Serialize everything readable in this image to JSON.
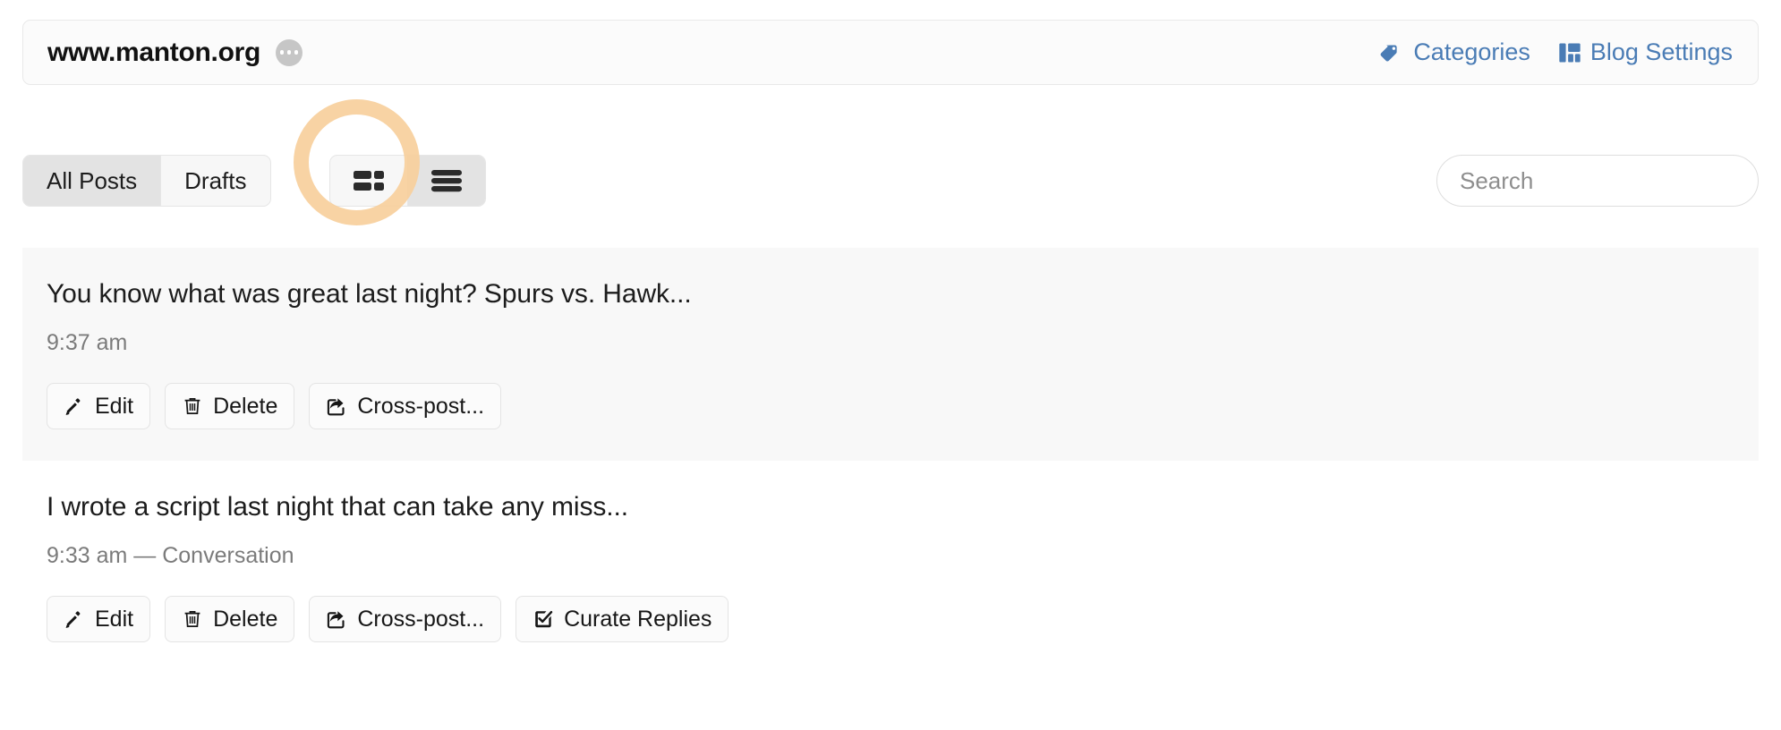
{
  "header": {
    "site_title": "www.manton.org",
    "more_button_label": "More options",
    "more_icon": "ellipsis-icon",
    "links": [
      {
        "label": "Categories",
        "icon": "tag-icon",
        "color": "#4a7cb5"
      },
      {
        "label": "Blog Settings",
        "icon": "layout-icon",
        "color": "#4a7cb5"
      }
    ]
  },
  "toolbar": {
    "tabs": [
      {
        "label": "All Posts",
        "selected": true
      },
      {
        "label": "Drafts",
        "selected": false
      }
    ],
    "views": [
      {
        "label": "Card view",
        "icon": "grid-view-icon",
        "selected": false
      },
      {
        "label": "List view",
        "icon": "list-view-icon",
        "selected": true
      }
    ],
    "search": {
      "placeholder": "Search",
      "value": ""
    }
  },
  "posts": [
    {
      "title": "You know what was great last night? Spurs vs. Hawk...",
      "meta": "9:37 am",
      "actions": [
        {
          "label": "Edit",
          "icon": "pencil-icon"
        },
        {
          "label": "Delete",
          "icon": "trash-icon"
        },
        {
          "label": "Cross-post...",
          "icon": "share-icon"
        }
      ]
    },
    {
      "title": "I wrote a script last night that can take any miss...",
      "meta": "9:33 am — Conversation",
      "actions": [
        {
          "label": "Edit",
          "icon": "pencil-icon"
        },
        {
          "label": "Delete",
          "icon": "trash-icon"
        },
        {
          "label": "Cross-post...",
          "icon": "share-icon"
        },
        {
          "label": "Curate Replies",
          "icon": "check-square-icon"
        }
      ]
    }
  ],
  "annotation": {
    "target": "list-view-toggle",
    "color": "#f7cf9c"
  }
}
